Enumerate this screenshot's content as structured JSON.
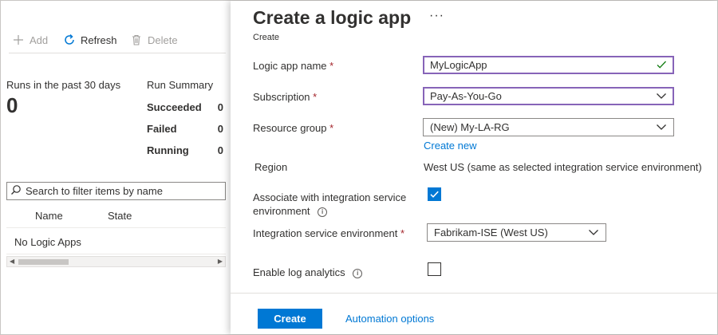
{
  "toolbar": {
    "add": "Add",
    "refresh": "Refresh",
    "delete": "Delete"
  },
  "runs": {
    "label": "Runs in the past 30 days",
    "count": "0"
  },
  "summary": {
    "title": "Run Summary",
    "rows": [
      {
        "label": "Succeeded",
        "value": "0"
      },
      {
        "label": "Failed",
        "value": "0"
      },
      {
        "label": "Running",
        "value": "0"
      }
    ]
  },
  "filter": {
    "placeholder": "Search to filter items by name"
  },
  "table": {
    "columns": [
      "Name",
      "State"
    ],
    "empty": "No Logic Apps"
  },
  "blade": {
    "title": "Create a logic app",
    "more": "···",
    "subtitle": "Create"
  },
  "form": {
    "name_label": "Logic app name",
    "name_value": "MyLogicApp",
    "subscription_label": "Subscription",
    "subscription_value": "Pay-As-You-Go",
    "rg_label": "Resource group",
    "rg_value": "(New) My-LA-RG",
    "create_new": "Create new",
    "region_label": "Region",
    "region_value": "West US (same as selected integration service environment)",
    "ise_assoc_label_1": "Associate with integration service",
    "ise_assoc_label_2": "environment",
    "ise_assoc_checked": true,
    "ise_label": "Integration service environment",
    "ise_value": "Fabrikam-ISE (West US)",
    "log_label": "Enable log analytics",
    "log_checked": false,
    "required_mark": "*",
    "info_glyph": "i"
  },
  "footer": {
    "create": "Create",
    "automation": "Automation options"
  },
  "colors": {
    "accent": "#0078d4",
    "focus": "#8764b8",
    "required": "#a4262c",
    "valid": "#107c10"
  },
  "icons": [
    "add-icon",
    "refresh-icon",
    "delete-icon",
    "search-icon",
    "more-icon",
    "checkmark-icon",
    "chevron-down-icon",
    "info-icon"
  ]
}
